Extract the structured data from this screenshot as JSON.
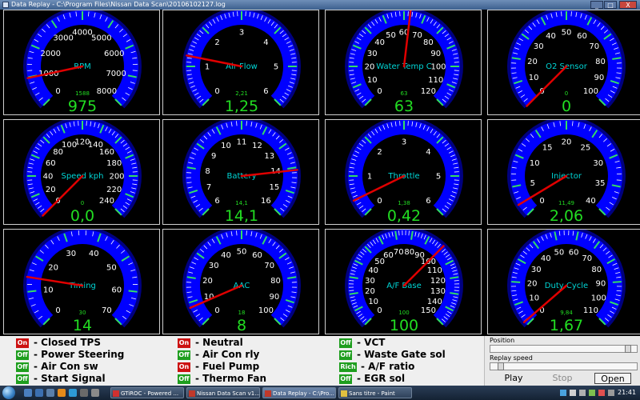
{
  "window": {
    "title": "Data Replay - C:\\Program Files\\Nissan Data Scan\\20106102127.log",
    "minimize": "_",
    "maximize": "□",
    "close": "X"
  },
  "colors": {
    "gauge_face": "#0000ff",
    "gauge_ring": "#000080",
    "needle": "#e00000",
    "digital": "#22dd22",
    "label": "#00d6d6",
    "status_off": "#1e9e1e",
    "status_on": "#cc1111"
  },
  "gauges": [
    {
      "id": "rpm",
      "name": "RPM",
      "min": 0,
      "max": 8000,
      "ticks": [
        "0",
        "1000",
        "2000",
        "3000",
        "4000",
        "5000",
        "6000",
        "7000",
        "8000"
      ],
      "minor": 4,
      "max_value": "1588",
      "value": 975,
      "display": "975"
    },
    {
      "id": "air-flow",
      "name": "Air Flow",
      "min": 0,
      "max": 6,
      "ticks": [
        "0",
        "1",
        "2",
        "3",
        "4",
        "5",
        "6"
      ],
      "minor": 9,
      "max_value": "2,21",
      "value": 1.25,
      "display": "1,25"
    },
    {
      "id": "water-temp",
      "name": "Water Temp C",
      "min": 0,
      "max": 120,
      "ticks": [
        "0",
        "10",
        "20",
        "30",
        "40",
        "50",
        "60",
        "70",
        "80",
        "90",
        "100",
        "110",
        "120"
      ],
      "minor": 4,
      "max_value": "63",
      "value": 63,
      "display": "63"
    },
    {
      "id": "o2-sensor",
      "name": "O2 Sensor",
      "min": 0,
      "max": 100,
      "ticks": [
        "0",
        "10",
        "20",
        "30",
        "40",
        "50",
        "60",
        "70",
        "80",
        "90",
        "100"
      ],
      "minor": 4,
      "max_value": "0",
      "value": 0,
      "display": "0"
    },
    {
      "id": "speed",
      "name": "Speed kph",
      "min": 0,
      "max": 240,
      "ticks": [
        "0",
        "20",
        "40",
        "60",
        "80",
        "100",
        "120",
        "140",
        "160",
        "180",
        "200",
        "220",
        "240"
      ],
      "minor": 4,
      "max_value": "0",
      "value": 0,
      "display": "0,0"
    },
    {
      "id": "battery",
      "name": "Battery",
      "min": 6,
      "max": 16,
      "ticks": [
        "6",
        "7",
        "8",
        "9",
        "10",
        "11",
        "12",
        "13",
        "14",
        "15",
        "16"
      ],
      "minor": 4,
      "max_value": "14,1",
      "value": 14.1,
      "display": "14,1"
    },
    {
      "id": "throttle",
      "name": "Throttle",
      "min": 0,
      "max": 6,
      "ticks": [
        "0",
        "1",
        "2",
        "3",
        "4",
        "5",
        "6"
      ],
      "minor": 9,
      "max_value": "1,38",
      "value": 0.42,
      "display": "0,42"
    },
    {
      "id": "injector",
      "name": "Injector",
      "min": 0,
      "max": 40,
      "ticks": [
        "0",
        "5",
        "10",
        "15",
        "20",
        "25",
        "30",
        "35",
        "40"
      ],
      "minor": 4,
      "max_value": "11,49",
      "value": 2.06,
      "display": "2,06"
    },
    {
      "id": "timing",
      "name": "Timing",
      "min": 0,
      "max": 70,
      "ticks": [
        "0",
        "10",
        "20",
        "30",
        "40",
        "50",
        "60",
        "70"
      ],
      "minor": 4,
      "max_value": "30",
      "value": 14,
      "display": "14"
    },
    {
      "id": "aac",
      "name": "AAC",
      "min": 0,
      "max": 100,
      "ticks": [
        "0",
        "10",
        "20",
        "30",
        "40",
        "50",
        "60",
        "70",
        "80",
        "90",
        "100"
      ],
      "minor": 4,
      "max_value": "18",
      "value": 8,
      "display": "8"
    },
    {
      "id": "af-base",
      "name": "A/F Base",
      "min": 0,
      "max": 150,
      "ticks": [
        "0",
        "10",
        "20",
        "30",
        "40",
        "50",
        "60",
        "70",
        "80",
        "90",
        "100",
        "110",
        "120",
        "130",
        "140",
        "150"
      ],
      "minor": 4,
      "max_value": "100",
      "value": 100,
      "display": "100"
    },
    {
      "id": "duty-cycle",
      "name": "Duty Cycle",
      "min": 0,
      "max": 110,
      "ticks": [
        "0",
        "10",
        "20",
        "30",
        "40",
        "50",
        "60",
        "70",
        "80",
        "90",
        "100",
        "110"
      ],
      "minor": 4,
      "max_value": "9,84",
      "value": 1.67,
      "display": "1,67"
    }
  ],
  "status": [
    [
      {
        "state": "On",
        "label": "- Closed TPS"
      },
      {
        "state": "Off",
        "label": "- Power Steering"
      },
      {
        "state": "Off",
        "label": "- Air Con sw"
      },
      {
        "state": "Off",
        "label": "- Start Signal"
      }
    ],
    [
      {
        "state": "On",
        "label": "- Neutral"
      },
      {
        "state": "Off",
        "label": "- Air Con rly"
      },
      {
        "state": "On",
        "label": "- Fuel Pump"
      },
      {
        "state": "Off",
        "label": "- Thermo Fan"
      }
    ],
    [
      {
        "state": "Off",
        "label": "- VCT"
      },
      {
        "state": "Off",
        "label": "- Waste Gate sol"
      },
      {
        "state": "Rich",
        "label": "- A/F ratio"
      },
      {
        "state": "Off",
        "label": "- EGR sol"
      }
    ]
  ],
  "controls": {
    "position_label": "Position",
    "position_value": 0.95,
    "replay_speed_label": "Replay speed",
    "replay_speed_value": 0.05,
    "play": "Play",
    "stop": "Stop",
    "open": "Open"
  },
  "taskbar": {
    "items": [
      {
        "label": "GTiROC - Powered ...",
        "active": false
      },
      {
        "label": "Nissan Data Scan v1...",
        "active": false
      },
      {
        "label": "Data Replay - C:\\Pro...",
        "active": true
      },
      {
        "label": "Sans titre - Paint",
        "active": false
      }
    ],
    "clock": "21:41"
  }
}
